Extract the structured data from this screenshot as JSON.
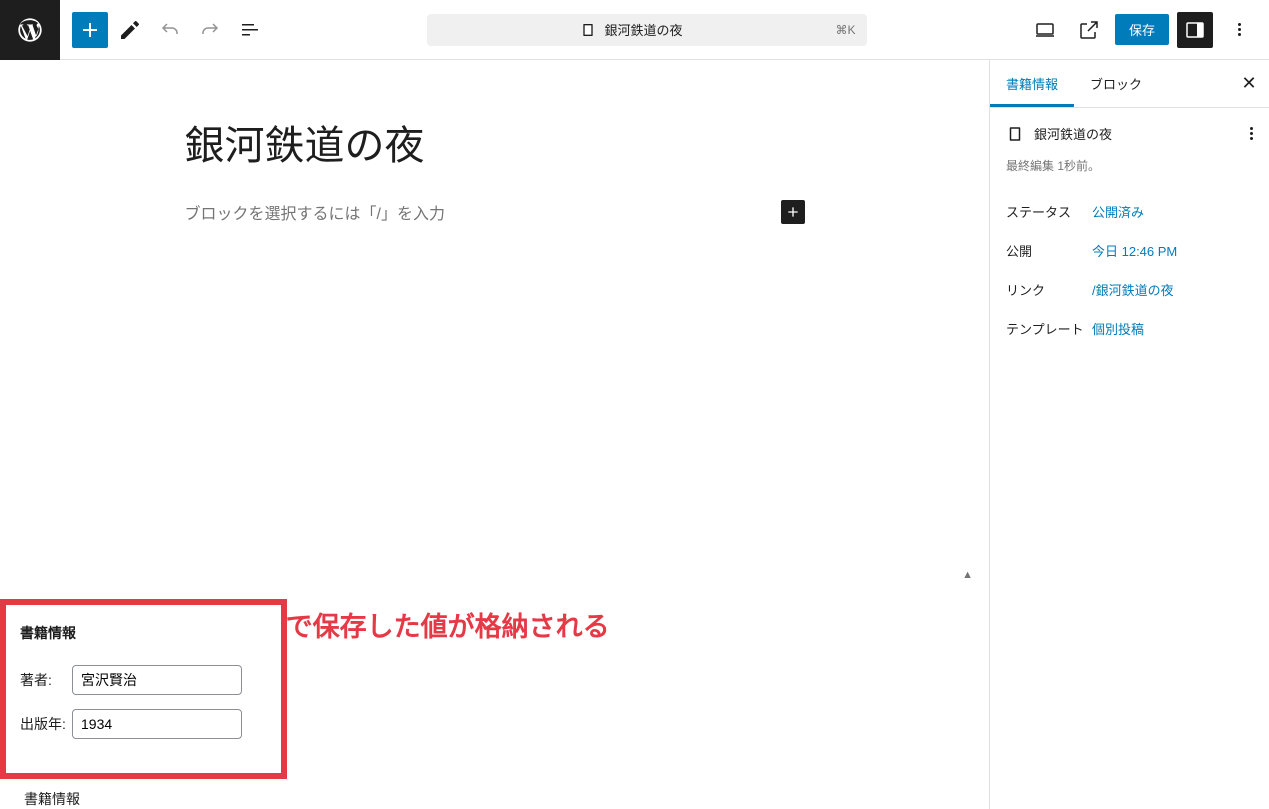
{
  "toolbar": {
    "doc_title": "銀河鉄道の夜",
    "shortcut": "⌘K",
    "save_label": "保存"
  },
  "editor": {
    "post_title": "銀河鉄道の夜",
    "block_prompt": "ブロックを選択するには「/」を入力"
  },
  "annotation": "save_post フックで保存した値が格納される",
  "metabox": {
    "title": "書籍情報",
    "author_label": "著者:",
    "author_value": "宮沢賢治",
    "year_label": "出版年:",
    "year_value": "1934",
    "footer_label": "書籍情報"
  },
  "sidebar": {
    "tab_info": "書籍情報",
    "tab_block": "ブロック",
    "doc_title": "銀河鉄道の夜",
    "last_edit": "最終編集 1秒前。",
    "rows": {
      "status_label": "ステータス",
      "status_value": "公開済み",
      "publish_label": "公開",
      "publish_value": "今日 12:46 PM",
      "link_label": "リンク",
      "link_value": "/銀河鉄道の夜",
      "template_label": "テンプレート",
      "template_value": "個別投稿"
    }
  }
}
